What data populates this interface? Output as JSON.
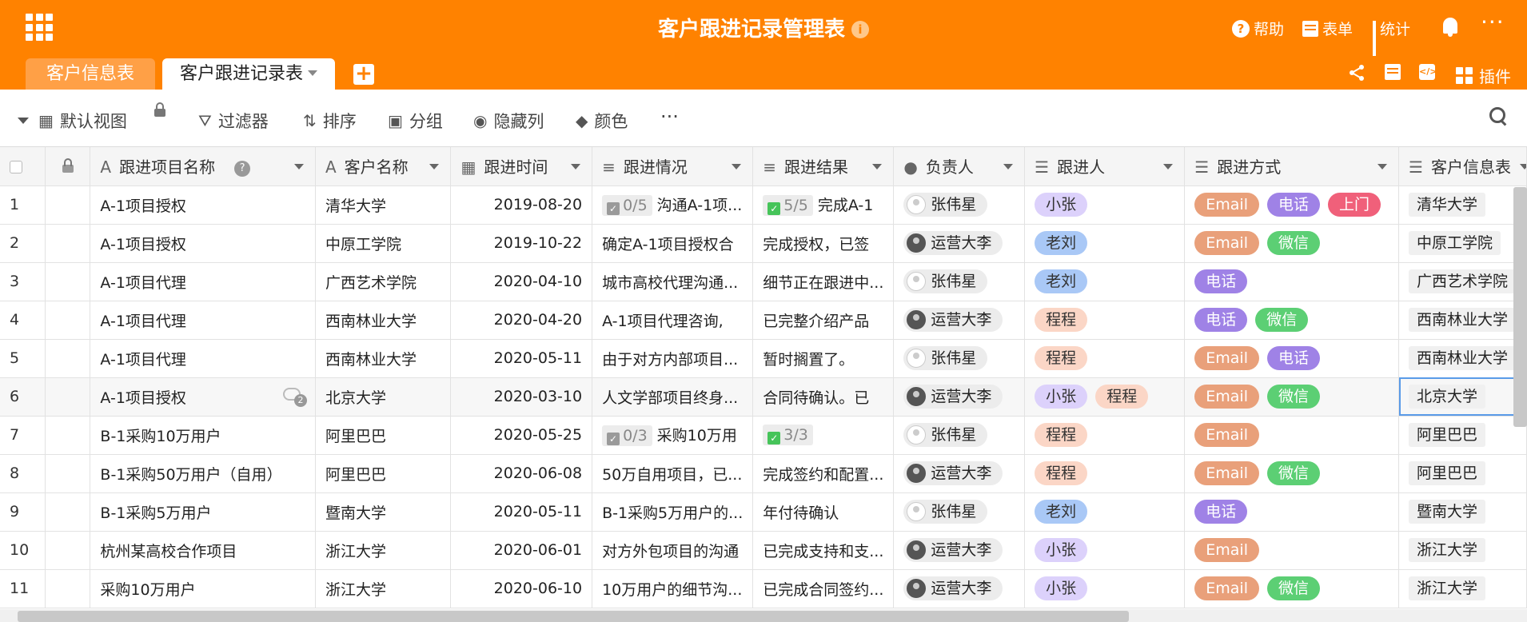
{
  "header": {
    "title": "客户跟进记录管理表",
    "help": "帮助",
    "form": "表单",
    "stats": "统计",
    "plugins": "插件"
  },
  "tabs": [
    {
      "label": "客户信息表"
    },
    {
      "label": "客户跟进记录表"
    }
  ],
  "toolbar": {
    "view": "默认视图",
    "filter": "过滤器",
    "sort": "排序",
    "group": "分组",
    "hide": "隐藏列",
    "color": "颜色"
  },
  "columns": [
    "跟进项目名称",
    "客户名称",
    "跟进时间",
    "跟进情况",
    "跟进结果",
    "负责人",
    "跟进人",
    "跟进方式",
    "客户信息表"
  ],
  "rows": [
    {
      "n": "1",
      "project": "A-1项目授权",
      "client": "清华大学",
      "date": "2019-08-20",
      "status_badge": "0/5",
      "status": "沟通A-1项...",
      "result_badge": "5/5",
      "result": "完成A-1",
      "owner": "张伟星",
      "owner_dark": false,
      "followers": [
        "小张"
      ],
      "methods": [
        "Email",
        "电话",
        "上门"
      ],
      "link": "清华大学"
    },
    {
      "n": "2",
      "project": "A-1项目授权",
      "client": "中原工学院",
      "date": "2019-10-22",
      "status": "确定A-1项目授权合",
      "result": "完成授权，已签",
      "owner": "运营大李",
      "owner_dark": true,
      "followers": [
        "老刘"
      ],
      "methods": [
        "Email",
        "微信"
      ],
      "link": "中原工学院"
    },
    {
      "n": "3",
      "project": "A-1项目代理",
      "client": "广西艺术学院",
      "date": "2020-04-10",
      "status": "城市高校代理沟通...",
      "result": "细节正在跟进中...",
      "owner": "张伟星",
      "owner_dark": false,
      "followers": [
        "老刘"
      ],
      "methods": [
        "电话"
      ],
      "link": "广西艺术学院"
    },
    {
      "n": "4",
      "project": "A-1项目代理",
      "client": "西南林业大学",
      "date": "2020-04-20",
      "status": "A-1项目代理咨询,",
      "result": "已完整介绍产品",
      "owner": "运营大李",
      "owner_dark": true,
      "followers": [
        "程程"
      ],
      "methods": [
        "电话",
        "微信"
      ],
      "link": "西南林业大学"
    },
    {
      "n": "5",
      "project": "A-1项目代理",
      "client": "西南林业大学",
      "date": "2020-05-11",
      "status": "由于对方内部项目...",
      "result": "暂时搁置了。",
      "owner": "张伟星",
      "owner_dark": false,
      "followers": [
        "程程"
      ],
      "methods": [
        "Email",
        "电话"
      ],
      "link": "西南林业大学"
    },
    {
      "n": "6",
      "project": "A-1项目授权",
      "client": "北京大学",
      "date": "2020-03-10",
      "status": "人文学部项目终身...",
      "result": "合同待确认。已",
      "owner": "运营大李",
      "owner_dark": true,
      "followers": [
        "小张",
        "程程"
      ],
      "methods": [
        "Email",
        "微信"
      ],
      "link": "北京大学",
      "comments": "2"
    },
    {
      "n": "7",
      "project": "B-1采购10万用户",
      "client": "阿里巴巴",
      "date": "2020-05-25",
      "status_badge": "0/3",
      "status": "采购10万用",
      "result_badge": "3/3",
      "result": "",
      "owner": "张伟星",
      "owner_dark": false,
      "followers": [
        "程程"
      ],
      "methods": [
        "Email"
      ],
      "link": "阿里巴巴"
    },
    {
      "n": "8",
      "project": "B-1采购50万用户（自用）",
      "client": "阿里巴巴",
      "date": "2020-06-08",
      "status": "50万自用项目，已...",
      "result": "完成签约和配置...",
      "owner": "运营大李",
      "owner_dark": true,
      "followers": [
        "程程"
      ],
      "methods": [
        "Email",
        "微信"
      ],
      "link": "阿里巴巴"
    },
    {
      "n": "9",
      "project": "B-1采购5万用户",
      "client": "暨南大学",
      "date": "2020-05-11",
      "status": "B-1采购5万用户的...",
      "result": "年付待确认",
      "owner": "张伟星",
      "owner_dark": false,
      "followers": [
        "老刘"
      ],
      "methods": [
        "电话"
      ],
      "link": "暨南大学"
    },
    {
      "n": "10",
      "project": "杭州某高校合作项目",
      "client": "浙江大学",
      "date": "2020-06-01",
      "status": "对方外包项目的沟通",
      "result": "已完成支持和支...",
      "owner": "运营大李",
      "owner_dark": true,
      "followers": [
        "小张"
      ],
      "methods": [
        "Email"
      ],
      "link": "浙江大学"
    },
    {
      "n": "11",
      "project": "采购10万用户",
      "client": "浙江大学",
      "date": "2020-06-10",
      "status": "10万用户的细节沟...",
      "result": "已完成合同签约...",
      "owner": "运营大李",
      "owner_dark": true,
      "followers": [
        "小张"
      ],
      "methods": [
        "Email",
        "微信"
      ],
      "link": "浙江大学"
    }
  ],
  "colors": {
    "brand": "#ff8200",
    "email": "#e9a07a",
    "phone": "#9f82e6",
    "wechat": "#5ccf74",
    "visit": "#f0607a"
  }
}
